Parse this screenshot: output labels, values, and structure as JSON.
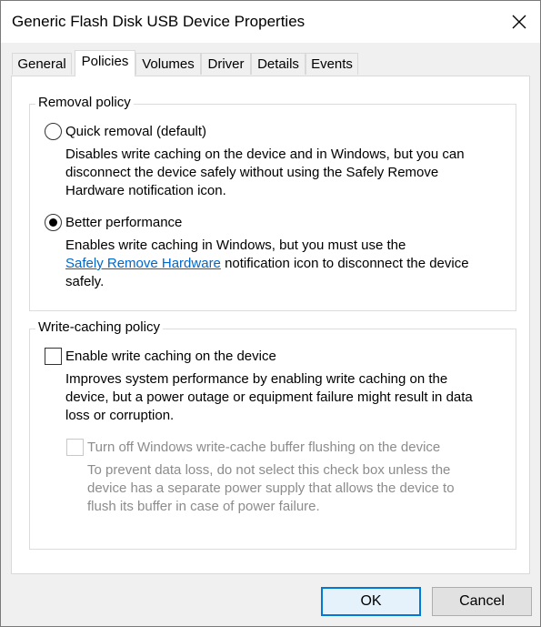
{
  "window": {
    "title": "Generic Flash Disk USB Device Properties"
  },
  "tabs": [
    {
      "label": "General"
    },
    {
      "label": "Policies"
    },
    {
      "label": "Volumes"
    },
    {
      "label": "Driver"
    },
    {
      "label": "Details"
    },
    {
      "label": "Events"
    }
  ],
  "active_tab": "Policies",
  "removal_policy": {
    "title": "Removal policy",
    "selected": "Better performance",
    "quick_removal": {
      "label": "Quick removal (default)",
      "description": "Disables write caching on the device and in Windows, but you can disconnect the device safely without using the Safely Remove Hardware notification icon.",
      "desc_line1": "Disables write caching on the device and in Windows, but you can",
      "desc_line2": "disconnect the device safely without using the Safely Remove",
      "desc_line3": "Hardware notification icon."
    },
    "better_performance": {
      "label": "Better performance",
      "desc_line1": "Enables write caching in Windows, but you must use the",
      "link_text": "Safely Remove Hardware",
      "desc_line2_rest": " notification icon to disconnect the device",
      "desc_line3": "safely."
    }
  },
  "write_caching_policy": {
    "title": "Write-caching policy",
    "enable_write_caching": {
      "label": "Enable write caching on the device",
      "checked": false,
      "desc_line1": "Improves system performance by enabling write caching on the",
      "desc_line2": "device, but a power outage or equipment failure might result in data",
      "desc_line3": "loss or corruption."
    },
    "turn_off_flushing": {
      "label": "Turn off Windows write-cache buffer flushing on the device",
      "checked": false,
      "disabled": true,
      "desc_line1": "To prevent data loss, do not select this check box unless the",
      "desc_line2": "device has a separate power supply that allows the device to",
      "desc_line3": "flush its buffer in case of power failure."
    }
  },
  "buttons": {
    "ok": "OK",
    "cancel": "Cancel"
  }
}
